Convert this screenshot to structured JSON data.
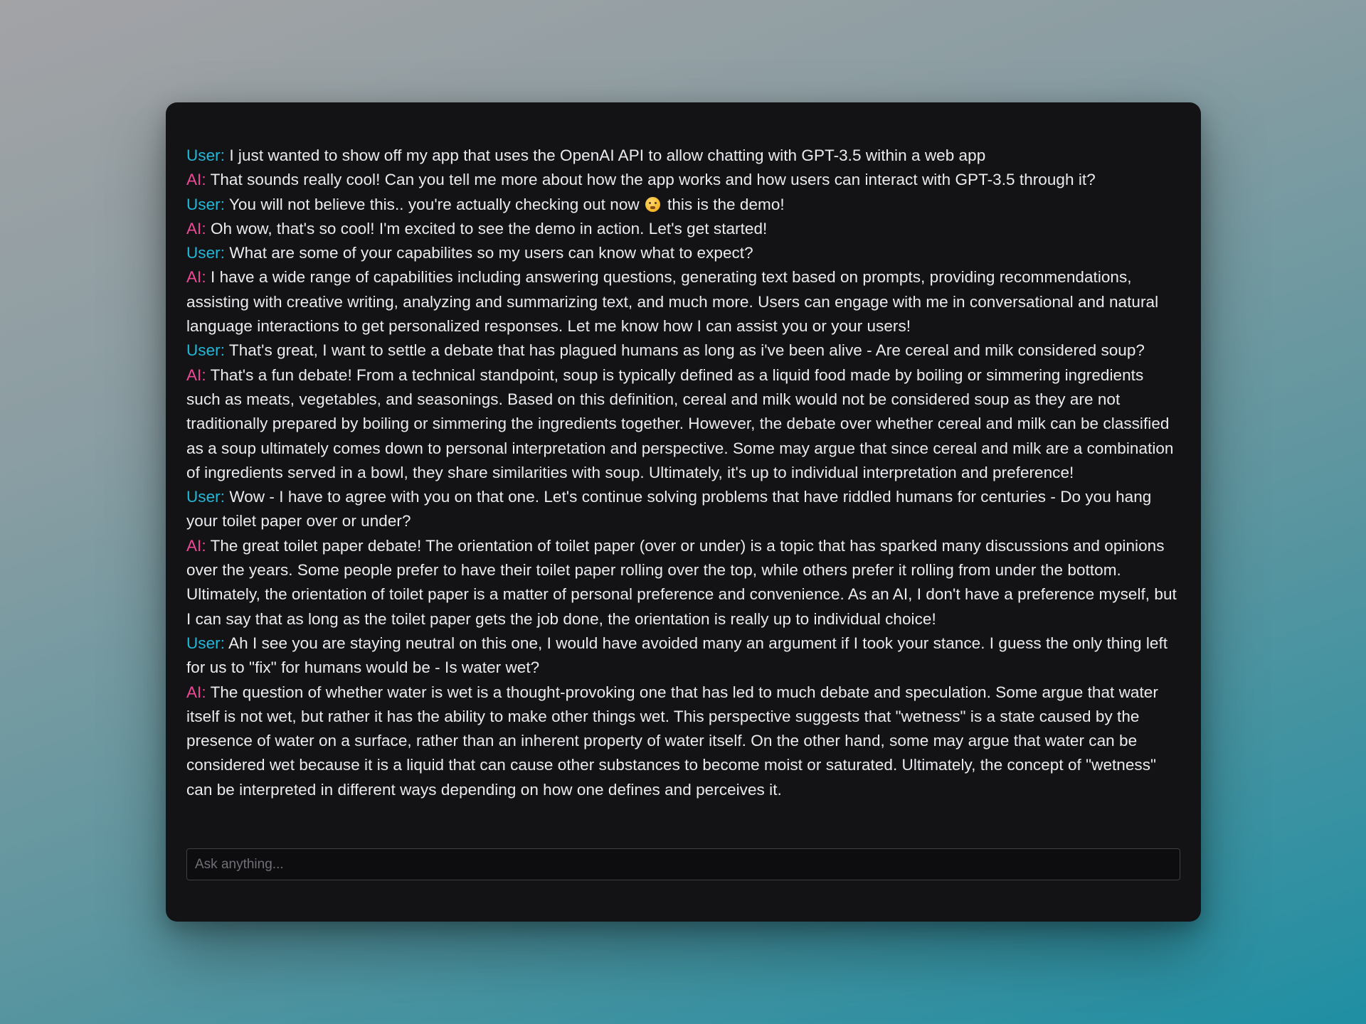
{
  "chat": {
    "messages": [
      {
        "speaker": "User:",
        "role": "user",
        "text": "I just wanted to show off my app that uses the OpenAI API to allow chatting with GPT-3.5 within a web app"
      },
      {
        "speaker": "AI:",
        "role": "ai",
        "text": "That sounds really cool! Can you tell me more about how the app works and how users can interact with GPT-3.5 through it?"
      },
      {
        "speaker": "User:",
        "role": "user",
        "text": "You will not believe this.. you're actually checking out now",
        "emoji": "shushing-face-icon",
        "text_after": "this is the demo!"
      },
      {
        "speaker": "AI:",
        "role": "ai",
        "text": "Oh wow, that's so cool! I'm excited to see the demo in action. Let's get started!"
      },
      {
        "speaker": "User:",
        "role": "user",
        "text": "What are some of your capabilites so my users can know what to expect?"
      },
      {
        "speaker": "AI:",
        "role": "ai",
        "text": "I have a wide range of capabilities including answering questions, generating text based on prompts, providing recommendations, assisting with creative writing, analyzing and summarizing text, and much more. Users can engage with me in conversational and natural language interactions to get personalized responses. Let me know how I can assist you or your users!"
      },
      {
        "speaker": "User:",
        "role": "user",
        "text": "That's great, I want to settle a debate that has plagued humans as long as i've been alive - Are cereal and milk considered soup?"
      },
      {
        "speaker": "AI:",
        "role": "ai",
        "text": "That's a fun debate! From a technical standpoint, soup is typically defined as a liquid food made by boiling or simmering ingredients such as meats, vegetables, and seasonings. Based on this definition, cereal and milk would not be considered soup as they are not traditionally prepared by boiling or simmering the ingredients together. However, the debate over whether cereal and milk can be classified as a soup ultimately comes down to personal interpretation and perspective. Some may argue that since cereal and milk are a combination of ingredients served in a bowl, they share similarities with soup. Ultimately, it's up to individual interpretation and preference!"
      },
      {
        "speaker": "User:",
        "role": "user",
        "text": "Wow - I have to agree with you on that one. Let's continue solving problems that have riddled humans for centuries - Do you hang your toilet paper over or under?"
      },
      {
        "speaker": "AI:",
        "role": "ai",
        "text": "The great toilet paper debate! The orientation of toilet paper (over or under) is a topic that has sparked many discussions and opinions over the years. Some people prefer to have their toilet paper rolling over the top, while others prefer it rolling from under the bottom. Ultimately, the orientation of toilet paper is a matter of personal preference and convenience. As an AI, I don't have a preference myself, but I can say that as long as the toilet paper gets the job done, the orientation is really up to individual choice!"
      },
      {
        "speaker": "User:",
        "role": "user",
        "text": "Ah I see you are staying neutral on this one, I would have avoided many an argument if I took your stance. I guess the only thing left for us to \"fix\" for humans would be - Is water wet?"
      },
      {
        "speaker": "AI:",
        "role": "ai",
        "text": "The question of whether water is wet is a thought-provoking one that has led to much debate and speculation. Some argue that water itself is not wet, but rather it has the ability to make other things wet. This perspective suggests that \"wetness\" is a state caused by the presence of water on a surface, rather than an inherent property of water itself. On the other hand, some may argue that water can be considered wet because it is a liquid that can cause other substances to become moist or saturated. Ultimately, the concept of \"wetness\" can be interpreted in different ways depending on how one defines and perceives it."
      }
    ]
  },
  "input": {
    "placeholder": "Ask anything...",
    "value": ""
  },
  "colors": {
    "user_label": "#22b8d8",
    "ai_label": "#ec4a95",
    "window_bg": "#131316",
    "text": "#ececf0"
  }
}
